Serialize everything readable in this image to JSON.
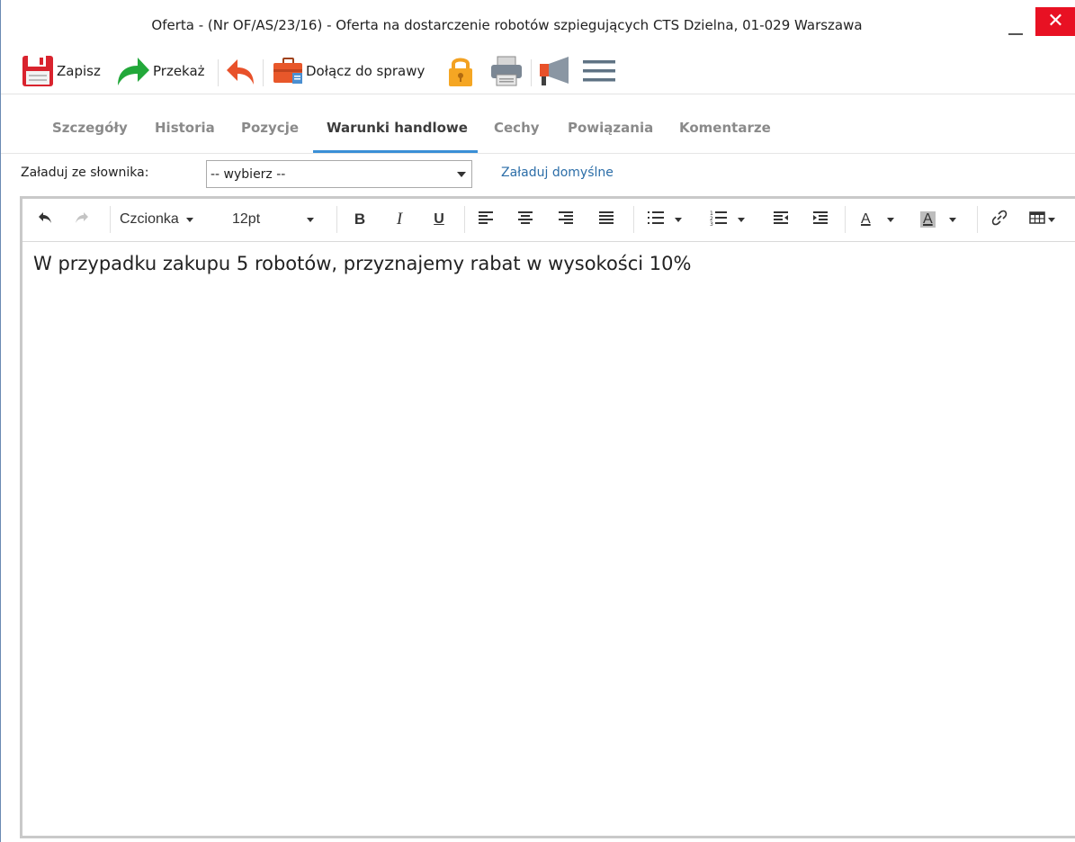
{
  "window": {
    "title": "Oferta - (Nr OF/AS/23/16) - Oferta na dostarczenie robotów szpiegujących CTS Dzielna, 01-029 Warszawa",
    "close_glyph": "✕"
  },
  "toolbar": {
    "save_label": "Zapisz",
    "forward_label": "Przekaż",
    "attach_label": "Dołącz do sprawy",
    "icons": [
      "floppy-disk-icon",
      "forward-arrow-icon",
      "reply-arrow-icon",
      "briefcase-icon",
      "padlock-icon",
      "printer-icon",
      "megaphone-icon",
      "hamburger-menu-icon"
    ]
  },
  "tabs": [
    {
      "label": "Szczegóły",
      "active": false
    },
    {
      "label": "Historia",
      "active": false
    },
    {
      "label": "Pozycje",
      "active": false
    },
    {
      "label": "Warunki handlowe",
      "active": true
    },
    {
      "label": "Cechy",
      "active": false
    },
    {
      "label": "Powiązania",
      "active": false
    },
    {
      "label": "Komentarze",
      "active": false
    }
  ],
  "dictionary": {
    "label": "Załaduj ze słownika:",
    "selected": "-- wybierz --",
    "load_default": "Załaduj domyślne"
  },
  "editor": {
    "font_menu": "Czcionka",
    "font_size": "12pt",
    "bold": "B",
    "italic": "I",
    "underline": "U",
    "text_color": "A",
    "bg_color": "A",
    "content": "W przypadku zakupu 5 robotów, przyznajemy rabat w wysokości 10%"
  },
  "colors": {
    "accent": "#3a8fd6",
    "close_button": "#e81123",
    "link": "#2c6ea8"
  }
}
